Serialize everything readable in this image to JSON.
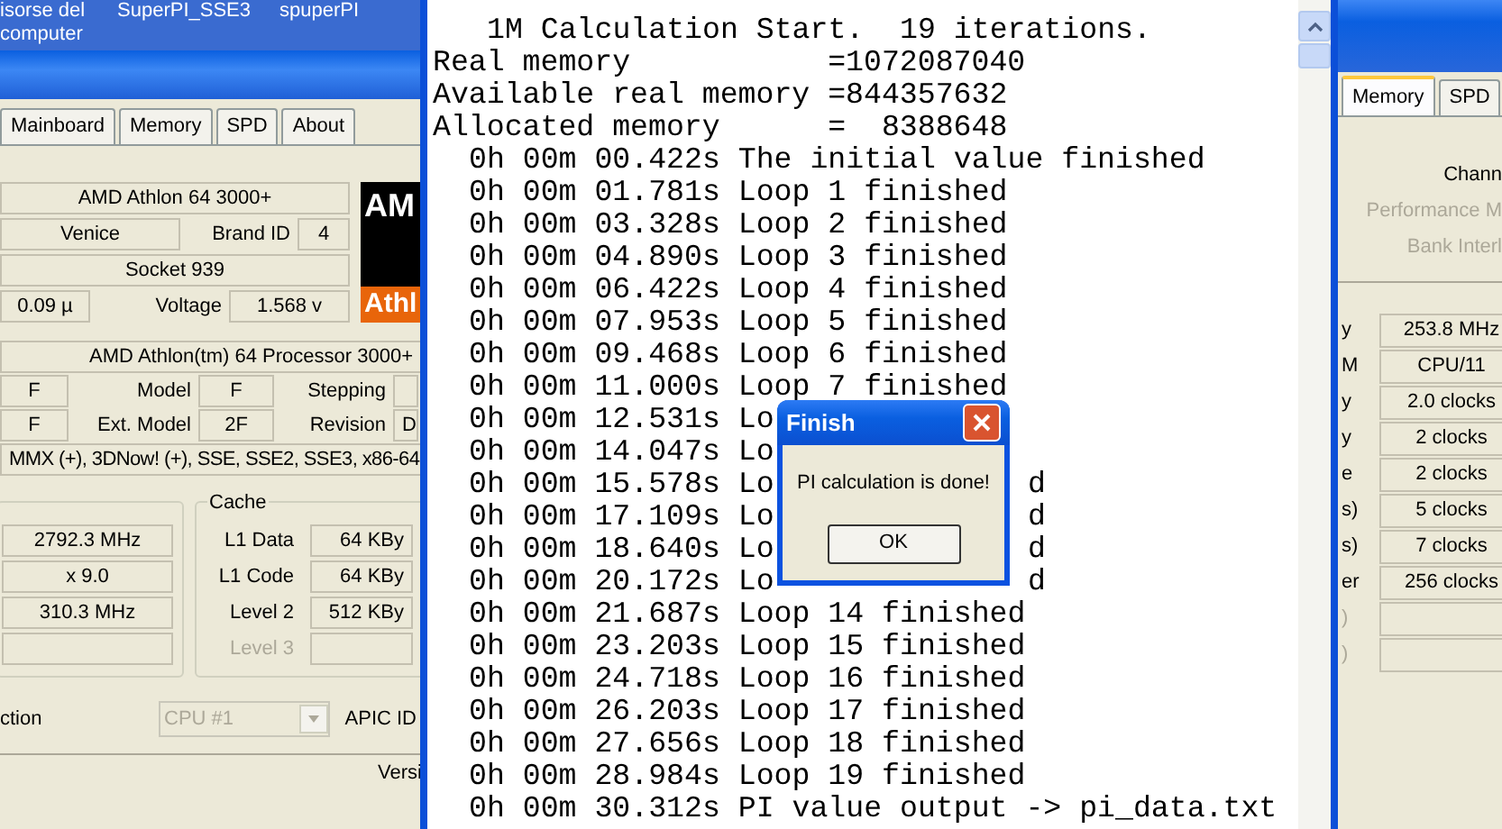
{
  "desktop_icons": [
    {
      "lines": [
        "isorse del",
        "computer"
      ]
    },
    {
      "lines": [
        "SuperPI_SSE3"
      ]
    },
    {
      "lines": [
        "spuperPI"
      ]
    }
  ],
  "cpuz_left": {
    "tabs": [
      {
        "label": "Mainboard",
        "selected": false
      },
      {
        "label": "Memory",
        "selected": false
      },
      {
        "label": "SPD",
        "selected": false
      },
      {
        "label": "About",
        "selected": false
      }
    ],
    "name": "AMD Athlon 64 3000+",
    "codename": "Venice",
    "brand_id_label": "Brand ID",
    "brand_id": "4",
    "package": "Socket 939",
    "technology": "0.09 µ",
    "voltage_label": "Voltage",
    "voltage": "1.568 v",
    "logo": [
      "AM",
      "Athl"
    ],
    "specification": "AMD Athlon(tm) 64 Processor 3000+",
    "family": "F",
    "model_label": "Model",
    "model": "F",
    "stepping_label": "Stepping",
    "ext_family": "F",
    "ext_model_label": "Ext. Model",
    "ext_model": "2F",
    "revision_label": "Revision",
    "revision": "D",
    "instructions": "MMX (+), 3DNow! (+), SSE, SSE2, SSE3, x86-64",
    "clocks": [
      "2792.3 MHz",
      "x 9.0",
      "310.3 MHz"
    ],
    "cache_title": "Cache",
    "cache": [
      {
        "label": "L1 Data",
        "value": "64 KBy",
        "disabled": false
      },
      {
        "label": "L1 Code",
        "value": "64 KBy",
        "disabled": false
      },
      {
        "label": "Level 2",
        "value": "512 KBy",
        "disabled": false
      },
      {
        "label": "Level 3",
        "disabled": true
      }
    ],
    "selection_label": "ction",
    "selection": {
      "value": "CPU #1",
      "disabled": true
    },
    "apic_label": "APIC ID",
    "version": "Versi"
  },
  "cpuz_right": {
    "tabs": [
      {
        "label": "Memory",
        "selected": true
      },
      {
        "label": "SPD",
        "selected": false
      }
    ],
    "general": [
      {
        "text": "Chann",
        "disabled": false
      },
      {
        "text": "Performance M",
        "disabled": true
      },
      {
        "text": "Bank Interl",
        "disabled": true
      }
    ],
    "timings": [
      {
        "label": "y",
        "value": "253.8 MHz",
        "disabled": false
      },
      {
        "label": "M",
        "value": "CPU/11",
        "disabled": false
      },
      {
        "label": "y",
        "value": "2.0 clocks",
        "disabled": false
      },
      {
        "label": "y",
        "value": "2 clocks",
        "disabled": false
      },
      {
        "label": "e",
        "value": "2 clocks",
        "disabled": false
      },
      {
        "label": "s)",
        "value": "5 clocks",
        "disabled": false
      },
      {
        "label": "s)",
        "value": "7 clocks",
        "disabled": false
      },
      {
        "label": "er",
        "value": "256 clocks",
        "disabled": false
      },
      {
        "label": ")",
        "disabled": true
      },
      {
        "label": ")",
        "disabled": true
      }
    ]
  },
  "log": {
    "lines": [
      {
        "kind": "title",
        "text": "1M Calculation Start.  19 iterations."
      },
      {
        "kind": "info",
        "text": "Real memory           =1072087040"
      },
      {
        "kind": "info",
        "text": "Available real memory =844357632"
      },
      {
        "kind": "info",
        "text": "Allocated memory      =  8388648"
      },
      {
        "kind": "time",
        "text": "0h 00m 00.422s The initial value finished"
      },
      {
        "kind": "time",
        "text": "0h 00m 01.781s Loop 1 finished"
      },
      {
        "kind": "time",
        "text": "0h 00m 03.328s Loop 2 finished"
      },
      {
        "kind": "time",
        "text": "0h 00m 04.890s Loop 3 finished"
      },
      {
        "kind": "time",
        "text": "0h 00m 06.422s Loop 4 finished"
      },
      {
        "kind": "time",
        "text": "0h 00m 07.953s Loop 5 finished"
      },
      {
        "kind": "time",
        "text": "0h 00m 09.468s Loop 6 finished"
      },
      {
        "kind": "time",
        "text": "0h 00m 11.000s Loop 7 finished"
      },
      {
        "kind": "time",
        "text": "0h 00m 12.531s Lo"
      },
      {
        "kind": "time",
        "text": "0h 00m 14.047s Lo"
      },
      {
        "kind": "time",
        "text": "0h 00m 15.578s Lo",
        "tail": "d"
      },
      {
        "kind": "time",
        "text": "0h 00m 17.109s Lo",
        "tail": "d"
      },
      {
        "kind": "time",
        "text": "0h 00m 18.640s Lo",
        "tail": "d"
      },
      {
        "kind": "time",
        "text": "0h 00m 20.172s Lo",
        "tail": "d"
      },
      {
        "kind": "time",
        "text": "0h 00m 21.687s Loop 14 finished"
      },
      {
        "kind": "time",
        "text": "0h 00m 23.203s Loop 15 finished"
      },
      {
        "kind": "time",
        "text": "0h 00m 24.718s Loop 16 finished"
      },
      {
        "kind": "time",
        "text": "0h 00m 26.203s Loop 17 finished"
      },
      {
        "kind": "time",
        "text": "0h 00m 27.656s Loop 18 finished"
      },
      {
        "kind": "time",
        "text": "0h 00m 28.984s Loop 19 finished"
      },
      {
        "kind": "time",
        "text": "0h 00m 30.312s PI value output -> pi_data.txt"
      }
    ]
  },
  "dialog": {
    "title": "Finish",
    "message": "PI calculation is done!",
    "button": "OK"
  }
}
